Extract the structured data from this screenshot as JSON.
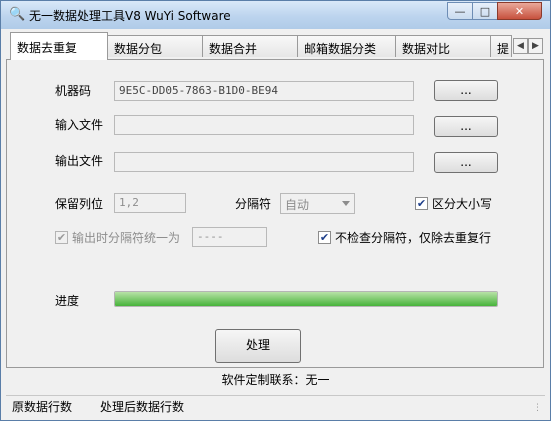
{
  "window": {
    "title": "无一数据处理工具V8   WuYi Software",
    "controls": {
      "minimize": "—",
      "maximize": "□",
      "close": "✕"
    }
  },
  "tabs": [
    {
      "label": "数据去重复",
      "active": true
    },
    {
      "label": "数据分包",
      "active": false
    },
    {
      "label": "数据合并",
      "active": false
    },
    {
      "label": "邮箱数据分类",
      "active": false
    },
    {
      "label": "数据对比",
      "active": false
    },
    {
      "label": "提",
      "active": false
    }
  ],
  "tab_scroll": {
    "left": "◀",
    "right": "▶"
  },
  "form": {
    "machine_code": {
      "label": "机器码",
      "value": "9E5C-DD05-7863-B1D0-BE94",
      "button": "..."
    },
    "input_file": {
      "label": "输入文件",
      "value": "",
      "button": "..."
    },
    "output_file": {
      "label": "输出文件",
      "value": "",
      "button": "..."
    },
    "keep_columns": {
      "label": "保留列位",
      "value": "1,2"
    },
    "separator": {
      "label": "分隔符",
      "selected": "自动"
    },
    "case_sensitive": {
      "label": "区分大小写",
      "checked": true
    },
    "unify_output_separator": {
      "label": "输出时分隔符统一为",
      "checked": true,
      "disabled": true,
      "value": "----"
    },
    "skip_separator_check": {
      "label": "不检查分隔符，仅除去重复行",
      "checked": true
    },
    "progress": {
      "label": "进度",
      "percent": 100
    },
    "process_button": "处理"
  },
  "footer": {
    "custom_contact": "软件定制联系：无一"
  },
  "statusbar": {
    "original_rows_label": "原数据行数",
    "processed_rows_label": "处理后数据行数"
  },
  "icons": {
    "app": "magnifier-icon",
    "checkbox": "check-icon",
    "grip": "resize-grip-icon"
  }
}
